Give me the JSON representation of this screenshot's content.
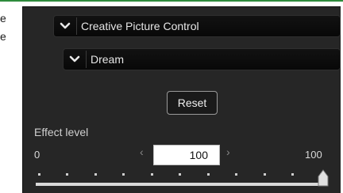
{
  "background_text": {
    "line1": "e",
    "line2": "e"
  },
  "panel": {
    "style_dropdown": {
      "label": "Creative Picture Control",
      "icon": "chevron-down-icon"
    },
    "preset_dropdown": {
      "label": "Dream",
      "icon": "chevron-down-icon"
    },
    "reset_label": "Reset",
    "effect": {
      "label": "Effect level",
      "min_label": "0",
      "max_label": "100",
      "value": "100",
      "decrement_icon": "chevron-left-icon",
      "increment_icon": "chevron-right-icon",
      "slider_level": 1.0
    }
  },
  "colors": {
    "accent_line": "#2e8b3c",
    "panel_bg": "#262626"
  }
}
